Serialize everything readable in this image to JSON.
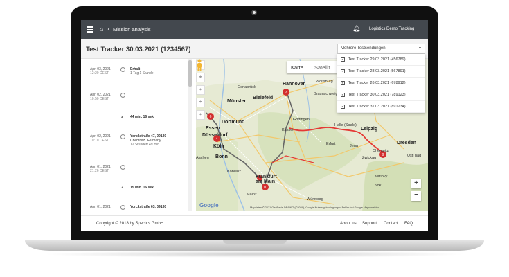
{
  "header": {
    "breadcrumb_sep": "›",
    "title": "Mission analysis",
    "user": "Logistics Demo Tracking",
    "icons": [
      "hamburger-icon",
      "home-icon",
      "bell-icon"
    ]
  },
  "page": {
    "title": "Test Tracker 30.03.2021 (1234567)",
    "select_value": "Mehrere Testsendungen"
  },
  "dropdown": {
    "items": [
      {
        "label": "Test Tracker 29.03.2021 (456789)",
        "checked": true
      },
      {
        "label": "Test Tracker 28.03.2021 (567891)",
        "checked": true
      },
      {
        "label": "Test Tracker 26.03.2021 (678912)",
        "checked": true
      },
      {
        "label": "Test Tracker 30.03.2021 (789123)",
        "checked": true
      },
      {
        "label": "Test Tracker 31.03.2021 (891234)",
        "checked": true
      }
    ]
  },
  "timeline": {
    "entries": [
      {
        "date": "Apr. 03, 2021",
        "time": "12:20 CEST",
        "place": "Erhalt",
        "sub": "1 Tag 1 Stunde",
        "detail": ""
      },
      {
        "date": "Apr. 02, 2021",
        "time": "10:50 CEST",
        "place": "",
        "sub": "",
        "detail": ""
      },
      {
        "date": "Apr. 02, 2021",
        "time": "10:10 CEST",
        "place": "Yorckstraße 47, 09130",
        "sub": "Chemnitz, Germany",
        "detail": "12 Stunden 49 min."
      },
      {
        "date": "Apr. 01, 2021",
        "time": "21:26 CEST",
        "place": "",
        "sub": "",
        "detail": ""
      },
      {
        "date": "Apr. 01, 2021",
        "time": "",
        "place": "Yorckstraße 63, 09130",
        "sub": "",
        "detail": ""
      }
    ],
    "gaps": [
      "44 min. 16 sek.",
      "15 min. 16 sek."
    ]
  },
  "map": {
    "toggle": {
      "map": "Karte",
      "satellite": "Satellit"
    },
    "zoom_in": "+",
    "zoom_out": "−",
    "logo": "Google",
    "credits": "Mapdaten © 2021 GeoBasis-DE/BKG (©2009), Google   Nutzungsbedingungen   Fehler bei Google Maps melden",
    "cities": [
      {
        "name": "Hannover",
        "big": true
      },
      {
        "name": "Osnabrück",
        "big": false
      },
      {
        "name": "Bielefeld",
        "big": true
      },
      {
        "name": "Münster",
        "big": true
      },
      {
        "name": "Wolfsburg",
        "big": false
      },
      {
        "name": "Braunschweig",
        "big": false
      },
      {
        "name": "Dortmund",
        "big": true
      },
      {
        "name": "Essen",
        "big": true
      },
      {
        "name": "Düsseldorf",
        "big": true
      },
      {
        "name": "Kassel",
        "big": false
      },
      {
        "name": "Göttingen",
        "big": false
      },
      {
        "name": "Halle (Saale)",
        "big": false
      },
      {
        "name": "Leipzig",
        "big": true
      },
      {
        "name": "Dresden",
        "big": true
      },
      {
        "name": "Köln",
        "big": true
      },
      {
        "name": "Bonn",
        "big": true
      },
      {
        "name": "Erfurt",
        "big": false
      },
      {
        "name": "Jena",
        "big": false
      },
      {
        "name": "Chemnitz",
        "big": false
      },
      {
        "name": "Zwickau",
        "big": false
      },
      {
        "name": "Koblenz",
        "big": false
      },
      {
        "name": "Frankfurt am Main",
        "big": true
      },
      {
        "name": "Mainz",
        "big": false
      },
      {
        "name": "Würzburg",
        "big": false
      },
      {
        "name": "Aachen",
        "big": false
      },
      {
        "name": "Usti nad",
        "big": false
      },
      {
        "name": "Karlovy",
        "big": false
      },
      {
        "name": "Sok",
        "big": false
      }
    ],
    "markers": [
      "2",
      "6",
      "4",
      "10",
      "2",
      "9"
    ]
  },
  "footer": {
    "copyright": "Copyright © 2018 by Spectos GmbH.",
    "links": [
      "About us",
      "Support",
      "Contact",
      "FAQ"
    ]
  },
  "colors": {
    "header": "#43484e",
    "route": "#e53935",
    "marker": "#d32f2f"
  }
}
